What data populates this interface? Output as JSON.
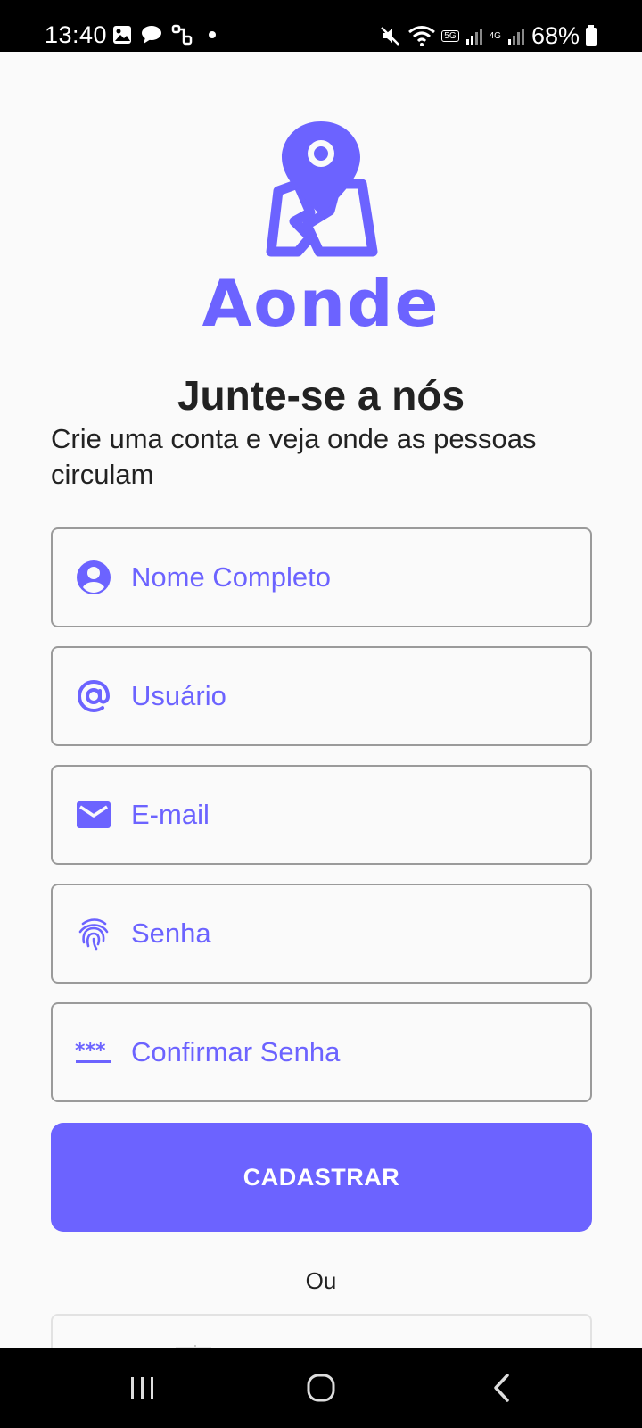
{
  "status_bar": {
    "time": "13:40",
    "battery_percent": "68%",
    "network_labels": [
      "5G",
      "4G"
    ]
  },
  "brand": {
    "name": "Aonde",
    "color": "#6c63ff"
  },
  "header": {
    "title": "Junte-se a nós",
    "subtitle": "Crie uma conta e veja onde as pessoas circulam"
  },
  "form": {
    "fields": [
      {
        "icon": "account-circle-icon",
        "placeholder": "Nome Completo",
        "value": ""
      },
      {
        "icon": "at-sign-icon",
        "placeholder": "Usuário",
        "value": ""
      },
      {
        "icon": "email-icon",
        "placeholder": "E-mail",
        "value": ""
      },
      {
        "icon": "fingerprint-icon",
        "placeholder": "Senha",
        "value": ""
      },
      {
        "icon": "password-dots-icon",
        "placeholder": "Confirmar Senha",
        "value": ""
      }
    ],
    "submit_label": "CADASTRAR",
    "divider_text": "Ou"
  },
  "colors": {
    "accent": "#6c63ff",
    "text": "#222222",
    "border": "#9a9a9a"
  }
}
